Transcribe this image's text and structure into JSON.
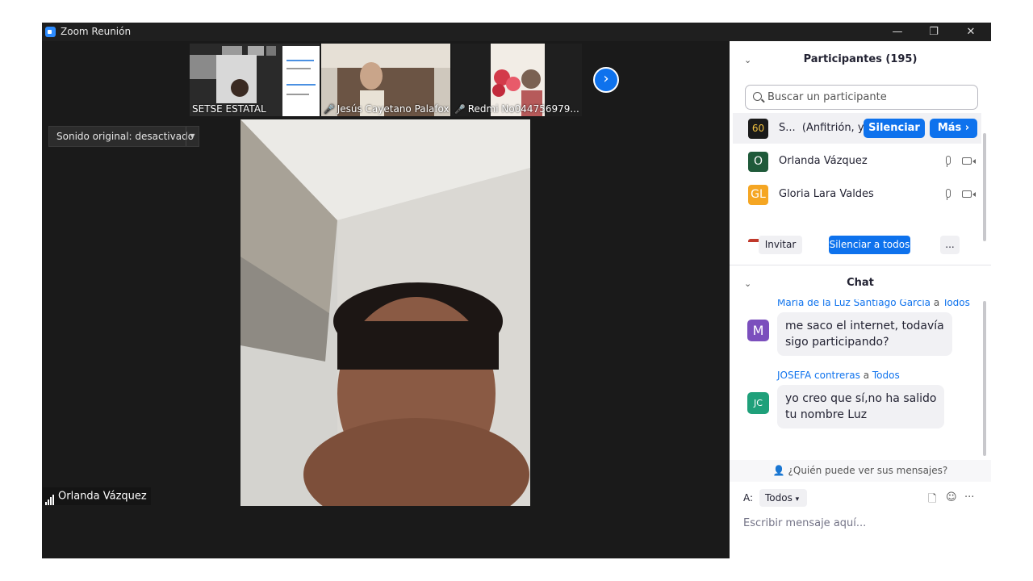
{
  "window": {
    "title": "Zoom Reunión",
    "minimize": "—",
    "restore": "❐",
    "close": "✕"
  },
  "stage": {
    "thumbnails": [
      {
        "name": "SETSE ESTATAL",
        "muted": false
      },
      {
        "name": "Jesús Cayetano Palafox",
        "muted": true
      },
      {
        "name": "Redmi No044756979...",
        "muted": true
      }
    ],
    "next_arrow": "›",
    "sound_dropdown": "Sonido original: desactivado",
    "speaker_name": "Orlanda Vázquez"
  },
  "participants": {
    "header": "Participantes (195)",
    "search_placeholder": "Buscar un participante",
    "rows": [
      {
        "name": "S...",
        "role": "(Anfitrión, yo)",
        "avatar": "60",
        "avatar_color": "#1a1a1a"
      },
      {
        "name": "Orlanda Vázquez",
        "avatar": "O",
        "avatar_color": "#1f5a3a"
      },
      {
        "name": "Gloria  Lara Valdes",
        "avatar": "GL",
        "avatar_color": "#f5a623"
      }
    ],
    "mute_btn": "Silenciar",
    "more_btn": "Más ›",
    "invite_btn": "Invitar",
    "mute_all_btn": "Silenciar a todos",
    "ellipsis_btn": "..."
  },
  "chat": {
    "header": "Chat",
    "messages": [
      {
        "sender": "María de la Luz Santiago García",
        "to": "a",
        "recipient": "Todos",
        "avatar": "M",
        "avatar_color": "#7b4fbd",
        "line1": "me saco el internet, todavía",
        "line2": "sigo participando?"
      },
      {
        "sender": "JOSEFA contreras",
        "to": "a",
        "recipient": "Todos",
        "avatar": "JC",
        "avatar_color": "#1fa07a",
        "line1": "yo creo que sí,no ha salido",
        "line2": "tu nombre Luz"
      }
    ],
    "who_can_see": "¿Quién puede ver sus mensajes?",
    "to_label": "A:",
    "to_value": "Todos",
    "more_tools": "···",
    "input_placeholder": "Escribir mensaje aquí..."
  }
}
